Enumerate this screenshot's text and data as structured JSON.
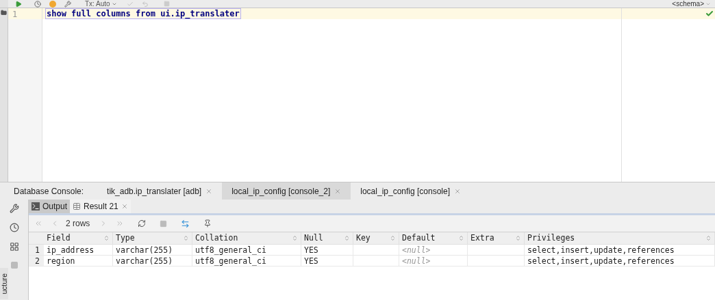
{
  "toolbar": {
    "transaction": "Tx: Auto",
    "schema": "<schema>"
  },
  "editor": {
    "lines": [
      {
        "number": "1",
        "code": "show full columns from ui.ip_translater",
        "selected": true
      }
    ]
  },
  "console_tabs": {
    "label": "Database Console:",
    "tabs": [
      {
        "label": "tik_adb.ip_translater [adb]",
        "selected": false
      },
      {
        "label": "local_ip_config [console_2]",
        "selected": true
      },
      {
        "label": "local_ip_config [console]",
        "selected": false
      }
    ]
  },
  "side_tab": "ucture",
  "result_tabs": [
    {
      "label": "Output",
      "kind": "output",
      "selected": false,
      "closable": false
    },
    {
      "label": "Result 21",
      "kind": "table",
      "selected": true,
      "closable": true
    }
  ],
  "row_count": "2 rows",
  "table": {
    "columns": [
      "Field",
      "Type",
      "Collation",
      "Null",
      "Key",
      "Default",
      "Extra",
      "Privileges"
    ],
    "rows": [
      {
        "number": "1",
        "cells": [
          "ip_address",
          "varchar(255)",
          "utf8_general_ci",
          "YES",
          "",
          "<null>",
          "",
          "select,insert,update,references"
        ]
      },
      {
        "number": "2",
        "cells": [
          "region",
          "varchar(255)",
          "utf8_general_ci",
          "YES",
          "",
          "<null>",
          "",
          "select,insert,update,references"
        ]
      }
    ]
  }
}
